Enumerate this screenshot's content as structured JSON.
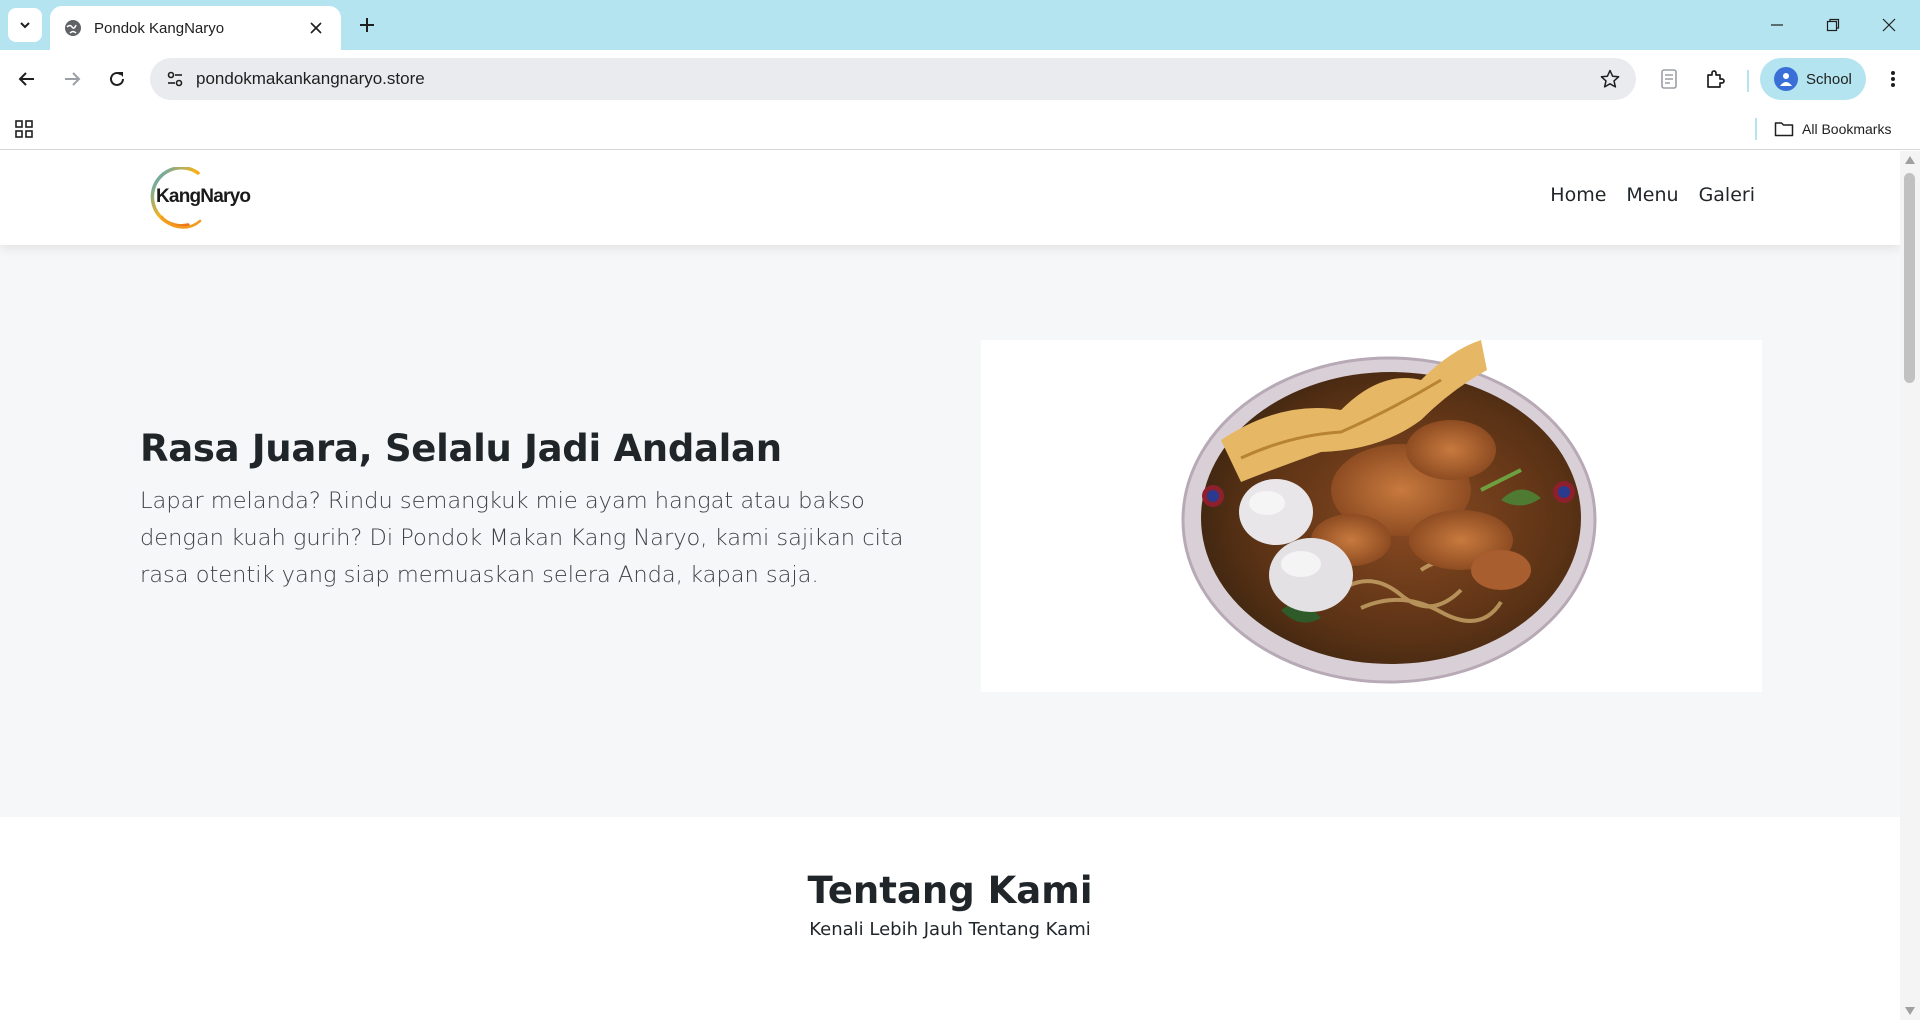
{
  "browser": {
    "tab_title": "Pondok KangNaryo",
    "url": "pondokmakankangnaryo.store",
    "profile_label": "School",
    "all_bookmarks_label": "All Bookmarks",
    "accent_color": "#b4e4f0"
  },
  "site": {
    "logo_text": "KangNaryo",
    "nav": {
      "home": "Home",
      "menu": "Menu",
      "galeri": "Galeri"
    },
    "hero": {
      "title": "Rasa Juara, Selalu Jadi Andalan",
      "text": "Lapar melanda? Rindu semangkuk mie ayam hangat atau bakso dengan kuah gurih? Di Pondok Makan Kang Naryo, kami sajikan cita rasa otentik yang siap memuaskan selera Anda, kapan saja.",
      "image_icon": "noodle-bowl-photo"
    },
    "about": {
      "title": "Tentang Kami",
      "subtitle": "Kenali Lebih Jauh Tentang Kami"
    }
  }
}
